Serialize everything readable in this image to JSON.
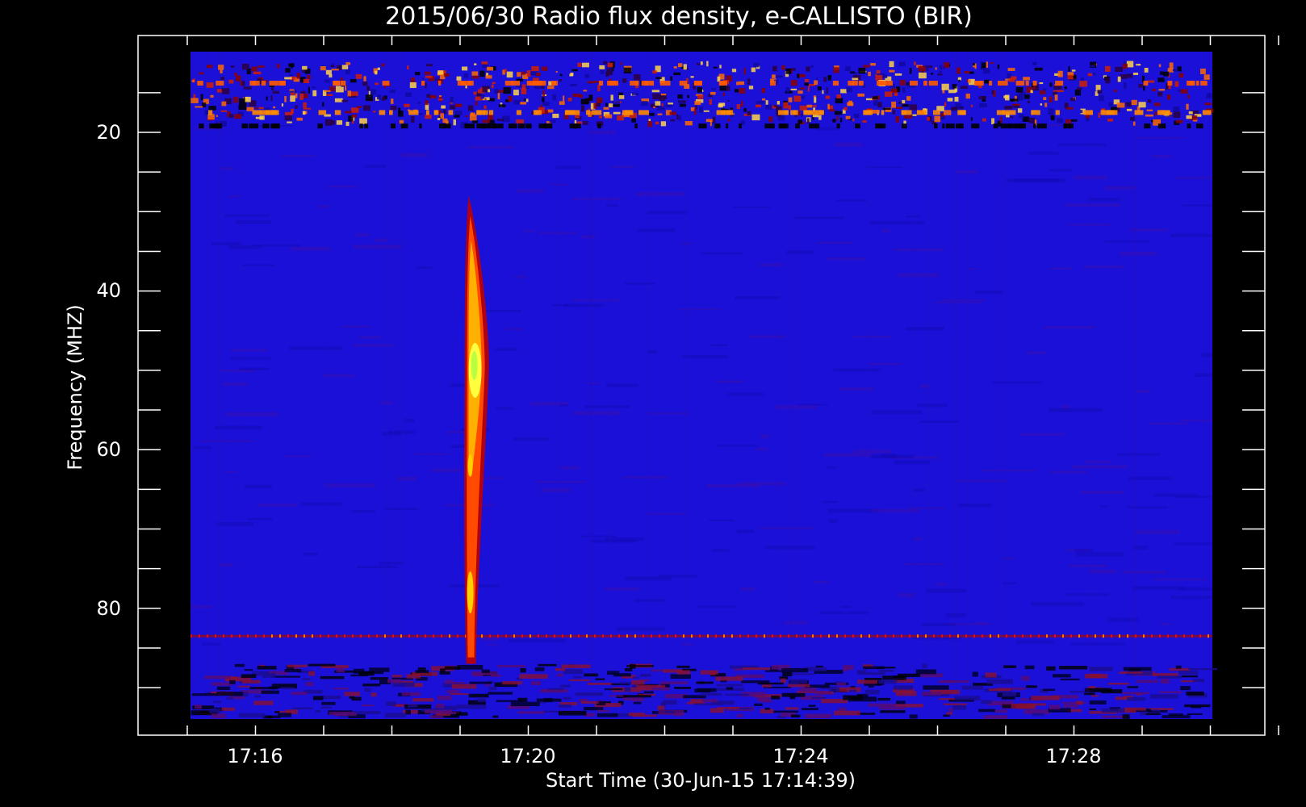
{
  "chart_data": {
    "type": "heatmap",
    "title": "2015/06/30  Radio flux density, e-CALLISTO (BIR)",
    "xlabel": "Start Time (30-Jun-15 17:14:39)",
    "ylabel": "Frequency (MHZ)",
    "x_ticks": [
      "17:16",
      "17:20",
      "17:24",
      "17:28"
    ],
    "y_ticks": [
      "20",
      "40",
      "60",
      "80"
    ],
    "x_range": [
      "17:14:39",
      "17:30:00"
    ],
    "y_range": [
      95,
      10
    ],
    "y_axis_inverted": true,
    "colormap": "blue-red-yellow",
    "background_color": "#1a10d8",
    "grid": false,
    "features": [
      {
        "kind": "radio burst",
        "time": "17:19:10",
        "freq_low": 28,
        "freq_high": 87,
        "peak_freq": 50
      },
      {
        "kind": "interference band",
        "freq_low": 11,
        "freq_high": 19
      },
      {
        "kind": "interference line",
        "freq": 83.5
      },
      {
        "kind": "interference band",
        "freq_low": 87,
        "freq_high": 95
      }
    ]
  }
}
